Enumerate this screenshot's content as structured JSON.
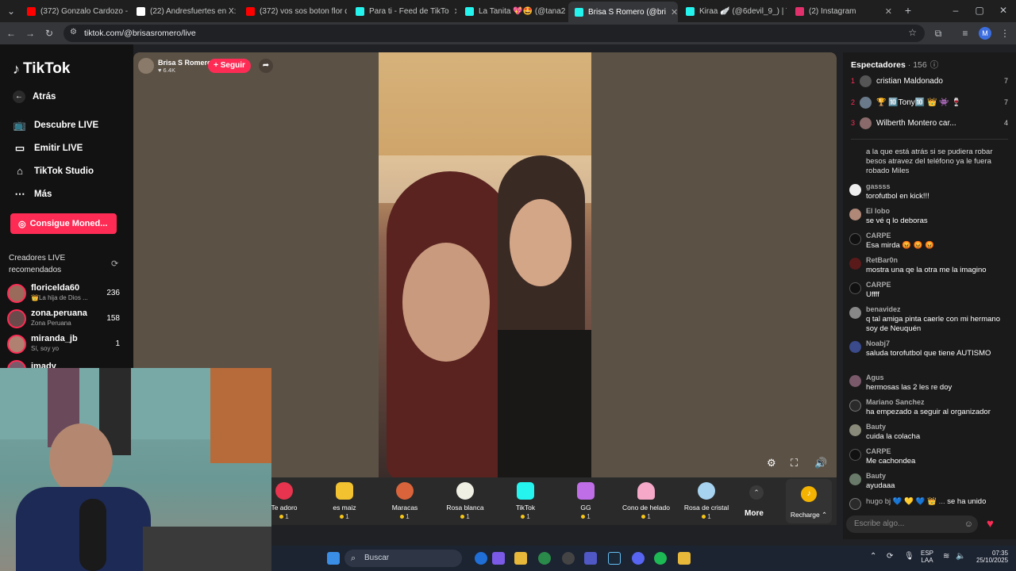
{
  "browser": {
    "tabs": [
      {
        "title": "(372) Gonzalo Cardozo -",
        "color": "#ff0000"
      },
      {
        "title": "(22) Andresfuertes en X:",
        "color": "#ffffff"
      },
      {
        "title": "(372) vos sos boton flor d",
        "color": "#ff0000"
      },
      {
        "title": "Para ti - Feed de TikTo",
        "color": "#25f4ee"
      },
      {
        "title": "La Tanita 💖🤩 (@tana2",
        "color": "#25f4ee"
      },
      {
        "title": "Brisa S Romero (@bri",
        "color": "#25f4ee"
      },
      {
        "title": "Kiraa 🪽 (@6devil_9_) | Ti",
        "color": "#25f4ee"
      },
      {
        "title": "(2) Instagram",
        "color": "#e1306c"
      }
    ],
    "url": "tiktok.com/@brisasromero/live",
    "profile_initial": "M"
  },
  "sidebar": {
    "logo": "TikTok",
    "back": "Atrás",
    "nav": [
      "Descubre LIVE",
      "Emitir LIVE",
      "TikTok Studio",
      "Más"
    ],
    "coins_button": "Consigue Moned...",
    "creators_title": "Creadores LIVE recomendados",
    "creators": [
      {
        "name": "floricelda60",
        "sub": "👑La hija de Dios ...",
        "count": "236"
      },
      {
        "name": "zona.peruana",
        "sub": "Zona Peruana",
        "count": "158"
      },
      {
        "name": "miranda_jb",
        "sub": "Sí, soy yo",
        "count": "1"
      },
      {
        "name": "imady",
        "sub": "",
        "count": ""
      }
    ]
  },
  "stream": {
    "host_name": "Brisa S Romero",
    "likes": "6.4K",
    "follow": "+ Seguir"
  },
  "gifts": [
    {
      "name": "Te adoro",
      "price": "1",
      "color": "#e8344e"
    },
    {
      "name": "es maiz",
      "price": "1",
      "color": "#f2c230"
    },
    {
      "name": "Maracas",
      "price": "1",
      "color": "#d9643b"
    },
    {
      "name": "Rosa blanca",
      "price": "1",
      "color": "#f0efe4"
    },
    {
      "name": "TikTok",
      "price": "1",
      "color": "#25f4ee"
    },
    {
      "name": "GG",
      "price": "1",
      "color": "#c06ee8"
    },
    {
      "name": "Cono de helado",
      "price": "1",
      "color": "#f5a8c8"
    },
    {
      "name": "Rosa de cristal",
      "price": "1",
      "color": "#a7d3f0"
    }
  ],
  "gift_more": "More",
  "recharge": "Recharge",
  "viewers": {
    "title": "Espectadores",
    "count": "156",
    "top": [
      {
        "rank": "1",
        "name": "cristian Maldonado",
        "count": "7"
      },
      {
        "rank": "2",
        "name": "🏆 🔟Tony🔟 👑 👾 🍷",
        "count": "7"
      },
      {
        "rank": "3",
        "name": "Wilberth Montero car...",
        "count": "4"
      }
    ]
  },
  "chat": [
    {
      "user": "",
      "text": "a la que está atrás si se pudiera robar besos atravez del teléfono ya le fuera robado Miles"
    },
    {
      "user": "gassss",
      "text": "torofutbol en kick!!!"
    },
    {
      "user": "El lobo",
      "text": "se vé q lo deboras"
    },
    {
      "user": "CARPE",
      "text": "Esa mirda 😡 😡 😡"
    },
    {
      "user": "RetBar0n",
      "text": "mostra una qe la otra me la imagino"
    },
    {
      "user": "CARPE",
      "text": "Uffff"
    },
    {
      "user": "benavidez",
      "text": "q tal amiga pinta caerle con mi hermano soy de Neuquén"
    },
    {
      "user": "Noabj7",
      "text": "saluda torofutbol que tiene AUTISMO"
    },
    {
      "user": "Agus",
      "text": "hermosas las 2 les re doy"
    },
    {
      "user": "Mariano Sanchez",
      "text": "ha empezado a seguir al organizador"
    },
    {
      "user": "Bauty",
      "text": "cuida la colacha"
    },
    {
      "user": "CARPE",
      "text": "Me cachondea"
    },
    {
      "user": "Bauty",
      "text": "ayudaaa"
    }
  ],
  "join_line": {
    "user": "hugo bj 💙 💛 💙 👑 ...",
    "text": "se ha unido"
  },
  "chat_placeholder": "Escribe algo...",
  "taskbar": {
    "search": "Buscar",
    "lang1": "ESP",
    "lang2": "LAA",
    "time": "07:35",
    "date": "25/10/2025"
  }
}
